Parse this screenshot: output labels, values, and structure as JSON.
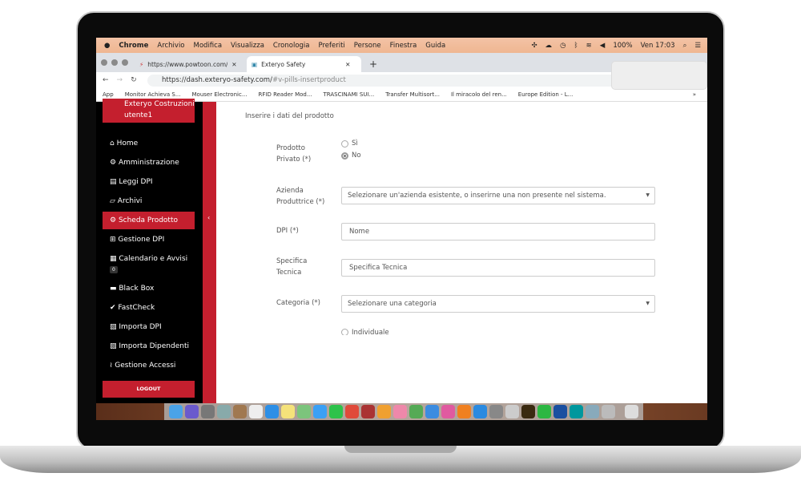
{
  "menubar": {
    "app": "Chrome",
    "items": [
      "Archivio",
      "Modifica",
      "Visualizza",
      "Cronologia",
      "Preferiti",
      "Persone",
      "Finestra",
      "Guida"
    ],
    "battery": "100%",
    "clock": "Ven 17:03"
  },
  "tabs": [
    {
      "label": "https://www.powtoon.com/htm"
    },
    {
      "label": "Exteryo Safety"
    }
  ],
  "address": {
    "host": "https://dash.exteryo-safety.com/",
    "path": "#v-pills-insertproduct"
  },
  "bookmarks": [
    "App",
    "Monitor Achieva S...",
    "Mouser Electronic...",
    "RFID Reader Mod...",
    "TRASCINAMI SUI...",
    "Transfer Multisort...",
    "Il miracolo del ren...",
    "Europe Edition - L..."
  ],
  "bookmarks_more": "»",
  "sidebar": {
    "company": "Exteryo Costruzioni",
    "user": "utente1",
    "items": [
      {
        "label": "Home",
        "icon": "home-icon"
      },
      {
        "label": "Amministrazione",
        "icon": "cogs-icon"
      },
      {
        "label": "Leggi DPI",
        "icon": "rss-square-icon"
      },
      {
        "label": "Archivi",
        "icon": "book-icon"
      },
      {
        "label": "Scheda Prodotto",
        "icon": "cogs-icon",
        "active": true
      },
      {
        "label": "Gestione DPI",
        "icon": "plus-square-icon"
      },
      {
        "label": "Calendario e Avvisi",
        "icon": "calendar-icon"
      },
      {
        "label": "Black Box",
        "icon": "archive-icon"
      },
      {
        "label": "FastCheck",
        "icon": "check-icon"
      },
      {
        "label": "Importa DPI",
        "icon": "file-excel-icon"
      },
      {
        "label": "Importa Dipendenti",
        "icon": "file-excel-icon"
      },
      {
        "label": "Gestione Accessi",
        "icon": "rss-icon"
      }
    ],
    "calendar_badge": "0",
    "logout": "LOGOUT",
    "collapse": "‹"
  },
  "form": {
    "heading": "Inserire i dati del prodotto",
    "private_label": "Prodotto Privato (*)",
    "private_options": [
      "Sì",
      "No"
    ],
    "private_selected": "No",
    "company_label": "Azienda Produttrice (*)",
    "company_select": "Selezionare un'azienda esistente, o inserirne una non presente nel sistema.",
    "dpi_label": "DPI (*)",
    "dpi_placeholder": "Nome",
    "spec_label": "Specifica Tecnica",
    "spec_placeholder": "Specifica Tecnica",
    "category_label": "Categoria (*)",
    "category_select": "Selezionare una categoria",
    "type_option": "Individuale"
  },
  "dock": [
    "finder",
    "siri",
    "launchpad",
    "preview",
    "notes-book",
    "calendar",
    "safari",
    "notes",
    "maps",
    "messages",
    "facetime",
    "chrome",
    "photo-booth",
    "pages",
    "photos",
    "numbers",
    "keynote",
    "itunes",
    "ibooks",
    "app-store",
    "system-preferences",
    "printer",
    "illustrator",
    "whatsapp",
    "wd",
    "arduino",
    "image-capture",
    "archive",
    "trash"
  ],
  "colors": {
    "accent": "#c41f2e",
    "sidebar": "#000000"
  }
}
